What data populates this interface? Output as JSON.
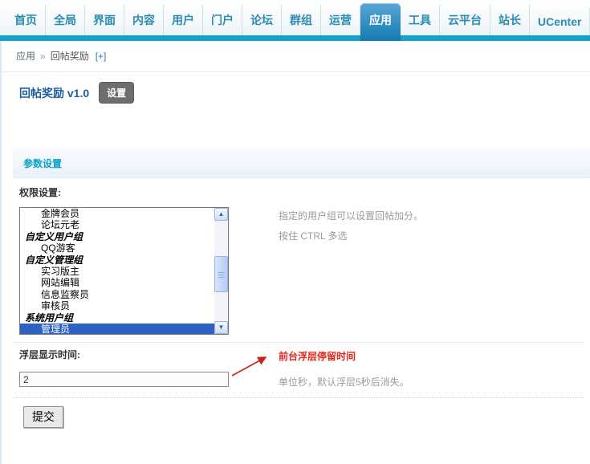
{
  "colors": {
    "accent": "#12a2c5",
    "tab-top": "#58a6d5",
    "tab-bottom": "#147ab2",
    "title-blue": "#1e5d9b",
    "section-title": "#0aa2c8",
    "selection": "#2e61c4",
    "annotation-red": "#e1261c",
    "help-gray": "#9a9a9a"
  },
  "nav": {
    "items": [
      {
        "label": "首页"
      },
      {
        "label": "全局"
      },
      {
        "label": "界面"
      },
      {
        "label": "内容"
      },
      {
        "label": "用户"
      },
      {
        "label": "门户"
      },
      {
        "label": "论坛"
      },
      {
        "label": "群组"
      },
      {
        "label": "运营"
      },
      {
        "label": "应用",
        "active": true
      },
      {
        "label": "工具"
      },
      {
        "label": "云平台"
      },
      {
        "label": "站长"
      },
      {
        "label": "UCenter"
      }
    ]
  },
  "breadcrumb": {
    "section": "应用",
    "separator": "»",
    "current": "回帖奖励",
    "expand": "[+]"
  },
  "plugin": {
    "title": "回帖奖励 v1.0",
    "settings_button": "设置"
  },
  "section": {
    "title": "参数设置"
  },
  "form": {
    "permission": {
      "label": "权限设置:",
      "options": [
        {
          "label": "金牌会员",
          "type": "option"
        },
        {
          "label": "论坛元老",
          "type": "option"
        },
        {
          "label": "自定义用户组",
          "type": "group"
        },
        {
          "label": "QQ游客",
          "type": "option"
        },
        {
          "label": "自定义管理组",
          "type": "group"
        },
        {
          "label": "实习版主",
          "type": "option"
        },
        {
          "label": "网站编辑",
          "type": "option"
        },
        {
          "label": "信息监察员",
          "type": "option"
        },
        {
          "label": "审核员",
          "type": "option"
        },
        {
          "label": "系统用户组",
          "type": "group"
        },
        {
          "label": "管理员",
          "type": "option",
          "selected": true
        }
      ],
      "help_line1": "指定的用户组可以设置回帖加分。",
      "help_line2": "按住 CTRL 多选"
    },
    "float_time": {
      "label": "浮层显示时间:",
      "value": "2",
      "annotation": "前台浮层停留时间",
      "help": "单位秒，默认浮层5秒后消失。"
    },
    "submit_label": "提交"
  }
}
